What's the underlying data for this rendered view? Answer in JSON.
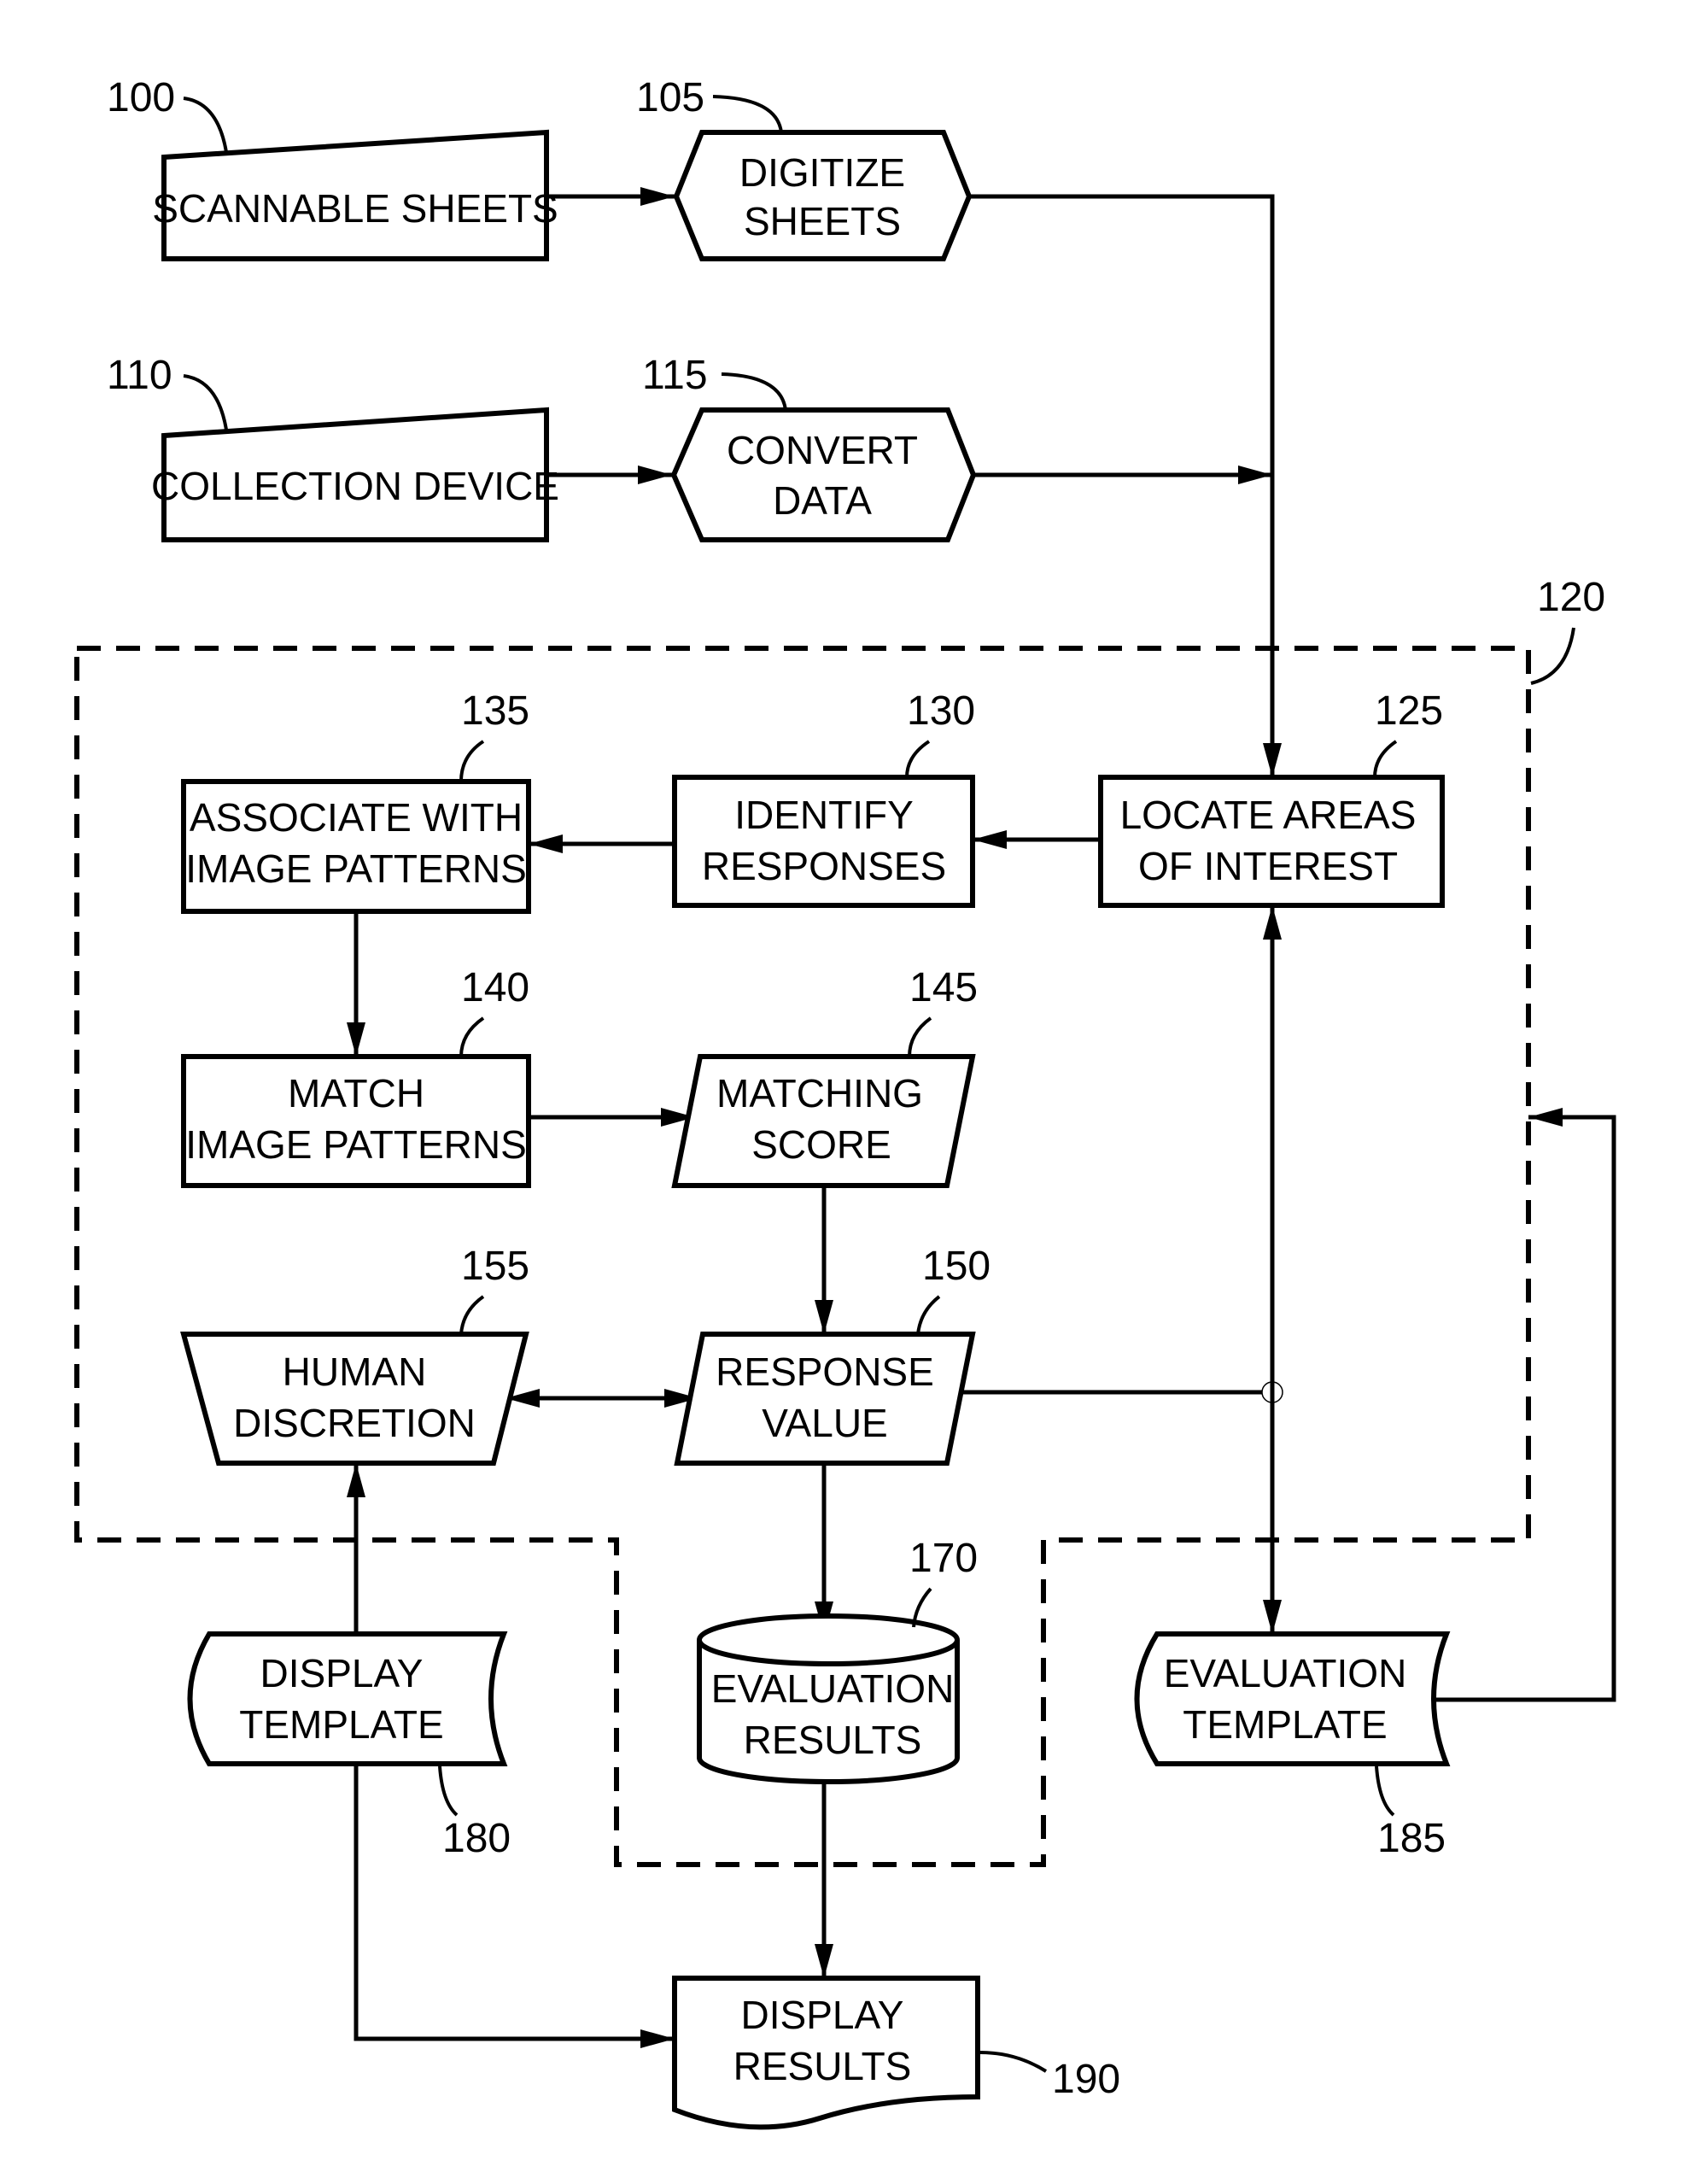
{
  "figure": {
    "container": {
      "ref": "120"
    },
    "nodes": {
      "scannable_sheets": {
        "ref": "100",
        "lines": [
          "SCANNABLE SHEETS"
        ]
      },
      "digitize_sheets": {
        "ref": "105",
        "lines": [
          "DIGITIZE",
          "SHEETS"
        ]
      },
      "collection_device": {
        "ref": "110",
        "lines": [
          "COLLECTION DEVICE"
        ]
      },
      "convert_data": {
        "ref": "115",
        "lines": [
          "CONVERT",
          "DATA"
        ]
      },
      "locate_areas": {
        "ref": "125",
        "lines": [
          "LOCATE AREAS",
          "OF INTEREST"
        ]
      },
      "identify_responses": {
        "ref": "130",
        "lines": [
          "IDENTIFY",
          "RESPONSES"
        ]
      },
      "associate_patterns": {
        "ref": "135",
        "lines": [
          "ASSOCIATE WITH",
          "IMAGE PATTERNS"
        ]
      },
      "match_patterns": {
        "ref": "140",
        "lines": [
          "MATCH",
          "IMAGE PATTERNS"
        ]
      },
      "matching_score": {
        "ref": "145",
        "lines": [
          "MATCHING",
          "SCORE"
        ]
      },
      "response_value": {
        "ref": "150",
        "lines": [
          "RESPONSE",
          "VALUE"
        ]
      },
      "human_discretion": {
        "ref": "155",
        "lines": [
          "HUMAN",
          "DISCRETION"
        ]
      },
      "evaluation_results": {
        "ref": "170",
        "lines": [
          "EVALUATION",
          "RESULTS"
        ]
      },
      "display_template": {
        "ref": "180",
        "lines": [
          "DISPLAY",
          "TEMPLATE"
        ]
      },
      "evaluation_template": {
        "ref": "185",
        "lines": [
          "EVALUATION",
          "TEMPLATE"
        ]
      },
      "display_results": {
        "ref": "190",
        "lines": [
          "DISPLAY",
          "RESULTS"
        ]
      }
    },
    "edges": [
      {
        "from": "scannable_sheets",
        "to": "digitize_sheets"
      },
      {
        "from": "collection_device",
        "to": "convert_data"
      },
      {
        "from": "digitize_sheets",
        "to": "locate_areas"
      },
      {
        "from": "convert_data",
        "to": "locate_areas"
      },
      {
        "from": "locate_areas",
        "to": "identify_responses"
      },
      {
        "from": "identify_responses",
        "to": "associate_patterns"
      },
      {
        "from": "associate_patterns",
        "to": "match_patterns"
      },
      {
        "from": "match_patterns",
        "to": "matching_score"
      },
      {
        "from": "matching_score",
        "to": "response_value"
      },
      {
        "from": "human_discretion",
        "to": "response_value",
        "bidirectional": true
      },
      {
        "from": "response_value",
        "to": "evaluation_results"
      },
      {
        "from": "locate_areas",
        "to": "evaluation_template",
        "bidirectional": true
      },
      {
        "from": "evaluation_template",
        "to": "container"
      },
      {
        "from": "display_template",
        "to": "human_discretion"
      },
      {
        "from": "display_template",
        "to": "display_results"
      },
      {
        "from": "evaluation_results",
        "to": "display_results"
      }
    ]
  }
}
